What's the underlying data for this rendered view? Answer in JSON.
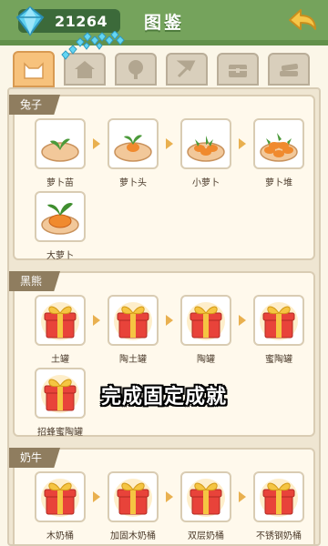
{
  "header": {
    "gem_count": "21264",
    "title": "图鉴"
  },
  "tabs": [
    {
      "icon": "cat-icon",
      "active": true
    },
    {
      "icon": "house-icon",
      "active": false
    },
    {
      "icon": "tree-icon",
      "active": false
    },
    {
      "icon": "axe-icon",
      "active": false
    },
    {
      "icon": "chest-icon",
      "active": false
    },
    {
      "icon": "books-icon",
      "active": false
    }
  ],
  "sections": [
    {
      "label": "兔子",
      "items": [
        {
          "name": "萝卜苗",
          "icon": "carrot-sprout-icon"
        },
        {
          "name": "萝卜头",
          "icon": "carrot-head-icon"
        },
        {
          "name": "小萝卜",
          "icon": "small-carrot-icon"
        },
        {
          "name": "萝卜堆",
          "icon": "carrot-pile-icon"
        },
        {
          "name": "大萝卜",
          "icon": "big-carrot-icon"
        }
      ]
    },
    {
      "label": "黑熊",
      "items": [
        {
          "name": "土罐",
          "icon": "gift-box-icon"
        },
        {
          "name": "陶土罐",
          "icon": "gift-box-icon"
        },
        {
          "name": "陶罐",
          "icon": "gift-box-icon"
        },
        {
          "name": "蜜陶罐",
          "icon": "gift-box-icon"
        },
        {
          "name": "招蜂蜜陶罐",
          "icon": "gift-box-icon"
        }
      ]
    },
    {
      "label": "奶牛",
      "items": [
        {
          "name": "木奶桶",
          "icon": "gift-box-icon"
        },
        {
          "name": "加固木奶桶",
          "icon": "gift-box-icon"
        },
        {
          "name": "双层奶桶",
          "icon": "gift-box-icon"
        },
        {
          "name": "不锈钢奶桶",
          "icon": "gift-box-icon"
        }
      ]
    }
  ],
  "caption": "完成固定成就",
  "colors": {
    "header": "#75a35c",
    "tab_active": "#f7c27c",
    "arrow": "#e9b04f",
    "gift_red": "#e8433a",
    "ribbon": "#f5c542"
  }
}
